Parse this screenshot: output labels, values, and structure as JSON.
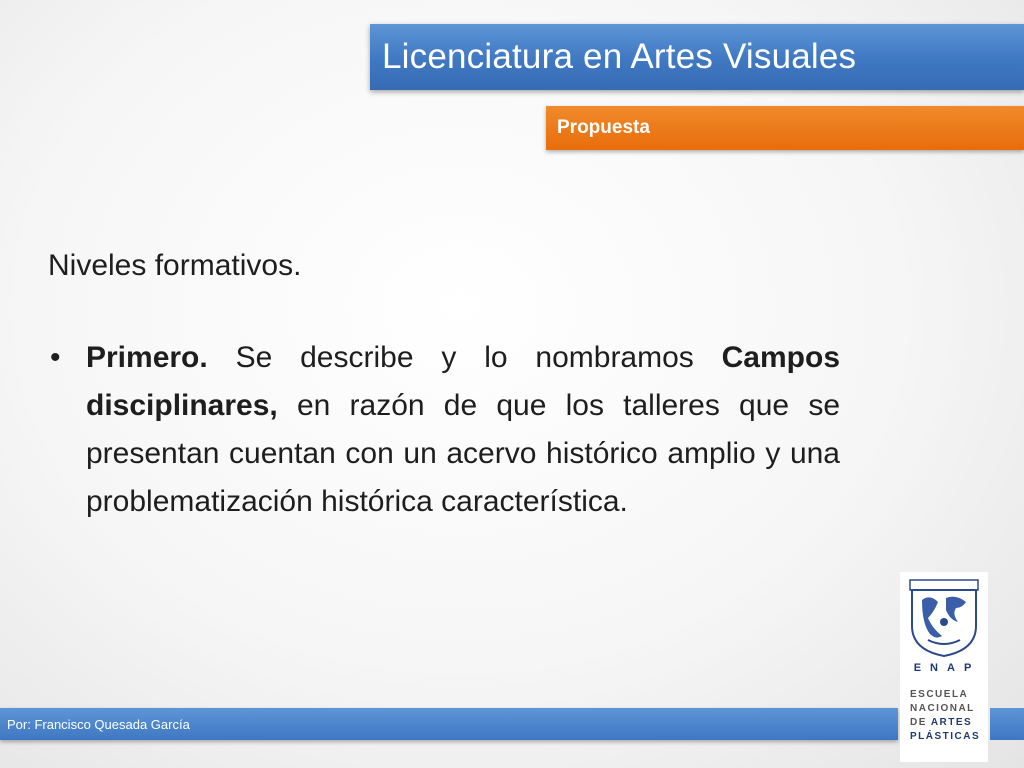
{
  "header": {
    "title": "Licenciatura en Artes Visuales",
    "section": "Propuesta"
  },
  "content": {
    "heading": "Niveles formativos.",
    "bullet": {
      "bold_lead": "Primero.",
      "text_1": " Se describe y lo nombramos ",
      "bold_term": "Campos disciplinares,",
      "text_2": " en razón de que los talleres que se presentan cuentan con un acervo histórico amplio y una problematización histórica característica."
    }
  },
  "footer": {
    "author": "Por: Francisco Quesada García"
  },
  "logo": {
    "acronym": "ENAP",
    "line1": "ESCUELA",
    "line2": "NACIONAL",
    "line3_prefix": "DE",
    "line3_strong": "ARTES",
    "line4": "PLÁSTICAS"
  },
  "colors": {
    "title_bar": "#3f78c2",
    "section_bar": "#e8730f",
    "footer_bar": "#4a83cb"
  }
}
